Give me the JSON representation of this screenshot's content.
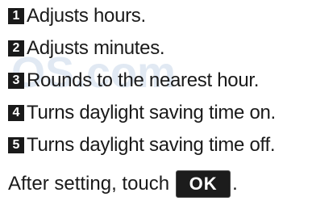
{
  "items": [
    {
      "number": "1",
      "text": "Adjusts hours."
    },
    {
      "number": "2",
      "text": "Adjusts minutes."
    },
    {
      "number": "3",
      "text": "Rounds to the nearest hour."
    },
    {
      "number": "4",
      "text": "Turns daylight saving time on."
    },
    {
      "number": "5",
      "text": "Turns daylight saving time off."
    }
  ],
  "final_line": {
    "text": "After setting, touch",
    "button_label": "OK",
    "trailing": "."
  },
  "watermark": {
    "text": "OS.com",
    "color": "#c9d8ea"
  },
  "colors": {
    "text": "#1a1a1a",
    "badge": "#1a1a1a",
    "button": "#1c1c1c"
  }
}
